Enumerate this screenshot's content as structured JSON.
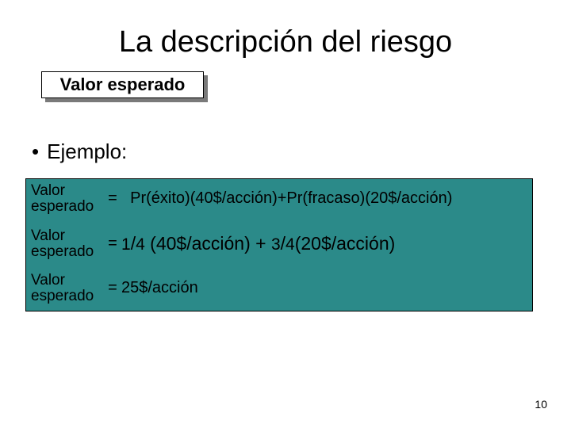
{
  "title": "La descripción del riesgo",
  "subtitle": "Valor esperado",
  "bullet_label": "Ejemplo:",
  "formula": {
    "label": "Valor\nesperado",
    "eq": "=",
    "line1_rhs": "Pr(éxito)(40$/acción)+Pr(fracaso)(20$/acción)",
    "line2_rhs_a": "1",
    "line2_rhs_b": "4",
    "line2_rhs_mid1": "(40$/acción)",
    "line2_rhs_plus": "+",
    "line2_rhs_c": "3",
    "line2_rhs_d": "4",
    "line2_rhs_mid2": "(20$/acción)",
    "line3_rhs": "25$/acción"
  },
  "page_number": "10"
}
